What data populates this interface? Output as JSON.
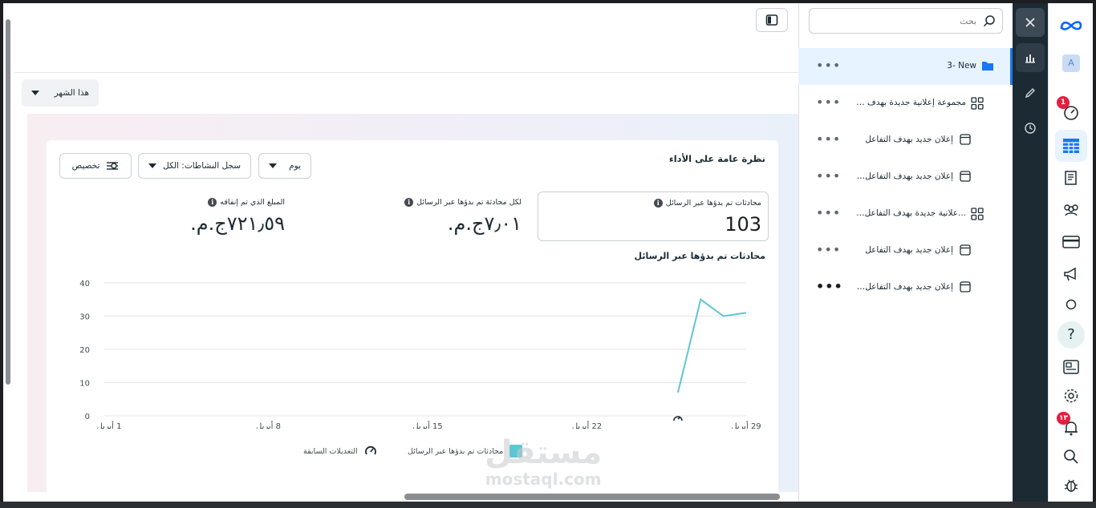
{
  "toolbar": {
    "month_filter": "هذا الشهر"
  },
  "tree": {
    "search_placeholder": "بحث",
    "items": [
      {
        "label": "3- New",
        "type": "campaign"
      },
      {
        "label": "مجموعة إعلانية جديدة بهدف التفاعل",
        "type": "adset"
      },
      {
        "label": "إعلان جديد بهدف التفاعل",
        "type": "ad"
      },
      {
        "label": "إعلان جديد بهدف التفاعل - نسخة",
        "type": "ad"
      },
      {
        "label": "...علانية جديدة بهدف التفاعل - نسخة",
        "type": "adset"
      },
      {
        "label": "إعلان جديد بهدف التفاعل",
        "type": "ad"
      },
      {
        "label": "إعلان جديد بهدف التفاعل - نسخة",
        "type": "ad"
      }
    ]
  },
  "rail": {
    "badge_1": "1",
    "badge_2": "١٣",
    "avatar_letter": "A"
  },
  "card": {
    "title": "نظرة عامة على الأداء",
    "day_label": "يوم",
    "activity_label": "سجل النشاطات: الكل",
    "customize_label": "تخصيص",
    "metrics": [
      {
        "label": "محادثات تم بدؤها عبر الرسائل",
        "value": "103"
      },
      {
        "label": "لكل محادثة تم بدؤها عبر الرسائل",
        "value": "٧٫٠١ج.م."
      },
      {
        "label": "المبلغ الذي تم إنفاقه",
        "value": "٧٢١٫٥٩ج.م."
      }
    ],
    "chart_title": "محادثات تم بدؤها عبر الرسائل",
    "legend_series": "محادثات تم بدؤها عبر الرسائل",
    "legend_edits": "التعديلات السابقة"
  },
  "watermark": {
    "line1": "مستقل",
    "line2": "mostaql.com"
  },
  "chart_data": {
    "type": "line",
    "x": [
      "1 أبريل",
      "8 أبريل",
      "15 أبريل",
      "22 أبريل",
      "29 أبريل"
    ],
    "xticks_day": [
      1,
      8,
      15,
      22,
      29
    ],
    "y_ticks": [
      0,
      10,
      20,
      30,
      40
    ],
    "ylim": [
      0,
      40
    ],
    "series": [
      {
        "name": "محادثات تم بدؤها عبر الرسائل",
        "color": "#5bc7d2",
        "points": [
          [
            26,
            7
          ],
          [
            27,
            35
          ],
          [
            28,
            30
          ],
          [
            29,
            31
          ]
        ]
      }
    ],
    "edit_marker_day": 26,
    "grid": true
  }
}
